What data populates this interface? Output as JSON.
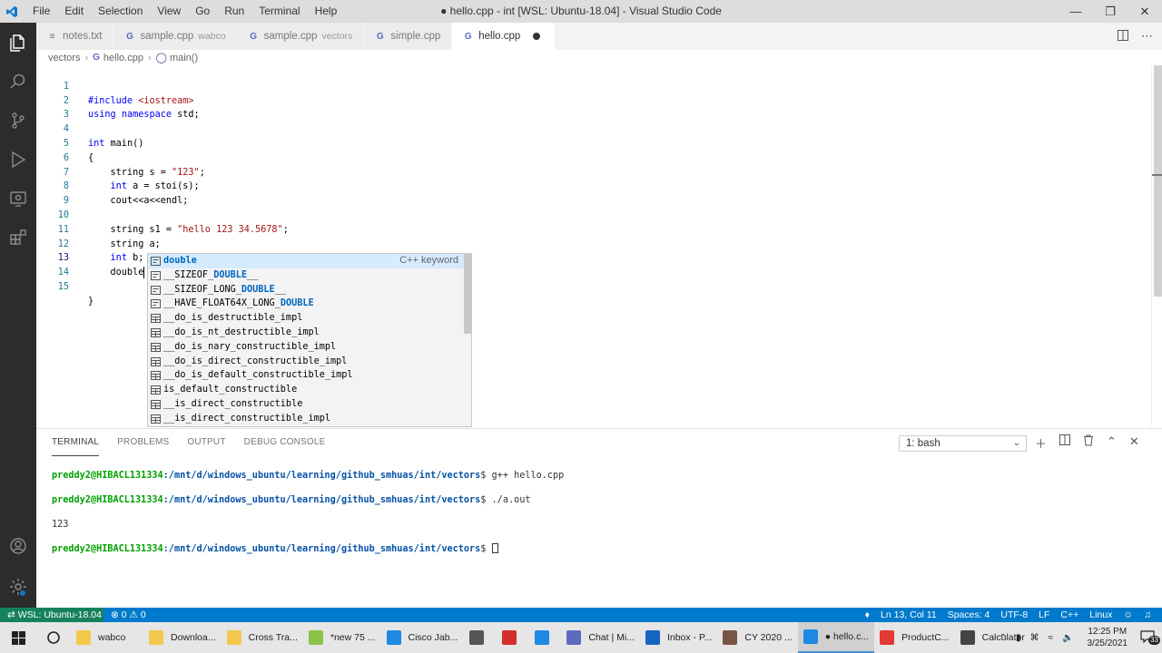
{
  "window": {
    "title": "● hello.cpp - int [WSL: Ubuntu-18.04] - Visual Studio Code",
    "menu": [
      "File",
      "Edit",
      "Selection",
      "View",
      "Go",
      "Run",
      "Terminal",
      "Help"
    ]
  },
  "tabs": [
    {
      "label": "notes.txt",
      "desc": "",
      "icon": "file-text-icon"
    },
    {
      "label": "sample.cpp",
      "desc": "wabco",
      "icon": "cpp-file-icon"
    },
    {
      "label": "sample.cpp",
      "desc": "vectors",
      "icon": "cpp-file-icon"
    },
    {
      "label": "simple.cpp",
      "desc": "",
      "icon": "cpp-file-icon"
    },
    {
      "label": "hello.cpp",
      "desc": "",
      "icon": "cpp-file-icon",
      "active": true,
      "dirty": true
    }
  ],
  "breadcrumb": {
    "folder": "vectors",
    "file": "hello.cpp",
    "symbol": "main()"
  },
  "editor": {
    "lines": [
      {
        "n": "1",
        "text": "#include <iostream>"
      },
      {
        "n": "2",
        "text": "using namespace std;"
      },
      {
        "n": "3",
        "text": ""
      },
      {
        "n": "4",
        "text": "int main()"
      },
      {
        "n": "5",
        "text": "{"
      },
      {
        "n": "6",
        "text": "    string s = \"123\";"
      },
      {
        "n": "7",
        "text": "    int a = stoi(s);"
      },
      {
        "n": "8",
        "text": "    cout<<a<<endl;"
      },
      {
        "n": "9",
        "text": ""
      },
      {
        "n": "10",
        "text": "    string s1 = \"hello 123 34.5678\";"
      },
      {
        "n": "11",
        "text": "    string a;"
      },
      {
        "n": "12",
        "text": "    int b;"
      },
      {
        "n": "13",
        "text": "    double"
      },
      {
        "n": "14",
        "text": ""
      },
      {
        "n": "15",
        "text": "}"
      }
    ]
  },
  "suggest": {
    "detail": "C++ keyword",
    "items": [
      {
        "pre": "",
        "hl": "double",
        "post": "",
        "kind": "keyword"
      },
      {
        "pre": "__SIZEOF_",
        "hl": "DOUBLE",
        "post": "__",
        "kind": "keyword"
      },
      {
        "pre": "__SIZEOF_LONG_",
        "hl": "DOUBLE",
        "post": "__",
        "kind": "keyword"
      },
      {
        "pre": "__HAVE_FLOAT64X_LONG_",
        "hl": "DOUBLE",
        "post": "",
        "kind": "keyword"
      },
      {
        "pre": "__do_is_destructible_impl",
        "hl": "",
        "post": "",
        "kind": "struct"
      },
      {
        "pre": "__do_is_nt_destructible_impl",
        "hl": "",
        "post": "",
        "kind": "struct"
      },
      {
        "pre": "__do_is_nary_constructible_impl",
        "hl": "",
        "post": "",
        "kind": "struct"
      },
      {
        "pre": "__do_is_direct_constructible_impl",
        "hl": "",
        "post": "",
        "kind": "struct"
      },
      {
        "pre": "__do_is_default_constructible_impl",
        "hl": "",
        "post": "",
        "kind": "struct"
      },
      {
        "pre": "is_default_constructible",
        "hl": "",
        "post": "",
        "kind": "struct"
      },
      {
        "pre": "__is_direct_constructible",
        "hl": "",
        "post": "",
        "kind": "struct"
      },
      {
        "pre": "__is_direct_constructible_impl",
        "hl": "",
        "post": "",
        "kind": "struct"
      }
    ]
  },
  "panel": {
    "tabs": [
      "TERMINAL",
      "PROBLEMS",
      "OUTPUT",
      "DEBUG CONSOLE"
    ],
    "terminal_select": "1: bash",
    "terminal": [
      {
        "prompt": "preddy2@HIBACL131334",
        "path": ":/mnt/d/windows_ubuntu/learning/github_smhuas/int/vectors",
        "cmd": "$ g++ hello.cpp"
      },
      {
        "prompt": "preddy2@HIBACL131334",
        "path": ":/mnt/d/windows_ubuntu/learning/github_smhuas/int/vectors",
        "cmd": "$ ./a.out"
      },
      {
        "output": "123"
      },
      {
        "prompt": "preddy2@HIBACL131334",
        "path": ":/mnt/d/windows_ubuntu/learning/github_smhuas/int/vectors",
        "cmd": "$ ",
        "cursor": true
      }
    ]
  },
  "statusbar": {
    "remote": "WSL: Ubuntu-18.04",
    "errors": "0",
    "warnings": "0",
    "position": "Ln 13, Col 11",
    "spaces": "Spaces: 4",
    "encoding": "UTF-8",
    "eol": "LF",
    "language": "C++",
    "platform": "Linux"
  },
  "taskbar": {
    "apps": [
      {
        "label": "wabco",
        "icon": "folder-icon",
        "color": "#f2c94c"
      },
      {
        "label": "Downloa...",
        "icon": "folder-icon",
        "color": "#f2c94c"
      },
      {
        "label": "Cross Tra...",
        "icon": "folder-icon",
        "color": "#f2c94c"
      },
      {
        "label": "*new 75 ...",
        "icon": "notepadpp-icon",
        "color": "#8bc34a"
      },
      {
        "label": "Cisco Jab...",
        "icon": "jabber-icon",
        "color": "#1e88e5"
      },
      {
        "label": "",
        "icon": "snipping-tool-icon",
        "color": "#555555"
      },
      {
        "label": "",
        "icon": "acrobat-icon",
        "color": "#d32f2f"
      },
      {
        "label": "",
        "icon": "edge-icon",
        "color": "#1e88e5"
      },
      {
        "label": "Chat | Mi...",
        "icon": "teams-icon",
        "color": "#5c6bc0"
      },
      {
        "label": "Inbox - P...",
        "icon": "outlook-icon",
        "color": "#1565c0"
      },
      {
        "label": "CY 2020 ...",
        "icon": "mail-icon",
        "color": "#795548"
      },
      {
        "label": "● hello.c...",
        "icon": "vscode-icon",
        "color": "#1e88e5",
        "active": true
      },
      {
        "label": "ProductC...",
        "icon": "chrome-icon",
        "color": "#e53935"
      },
      {
        "label": "Calculator",
        "icon": "calculator-icon",
        "color": "#444444"
      }
    ],
    "time": "12:25 PM",
    "date": "3/25/2021",
    "notifications": "33"
  }
}
